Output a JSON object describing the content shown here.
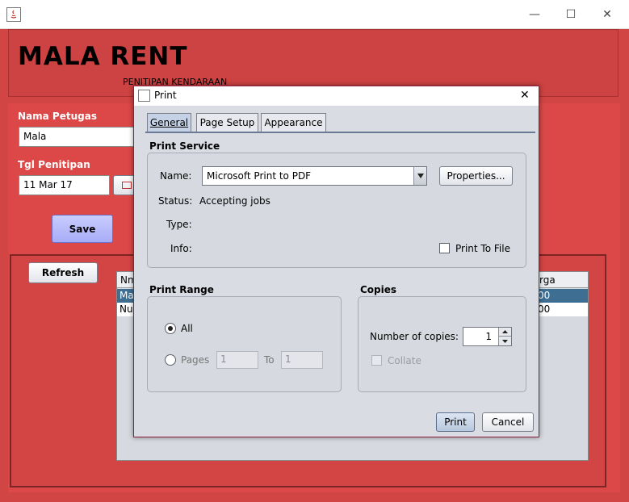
{
  "window": {
    "minimize": "—",
    "maximize": "☐",
    "close": "✕"
  },
  "app": {
    "brand": "MALA RENT",
    "subtitle": "PENITIPAN KENDARAAN",
    "petugas_label": "Nama Petugas",
    "petugas_value": "Mala",
    "tgl_label": "Tgl Penitipan",
    "tgl_value": "11 Mar 17",
    "save_label": "Save",
    "refresh_label": "Refresh",
    "right_hint": "r",
    "table": {
      "header_left": "Nm",
      "header_right": "rga",
      "rows": [
        {
          "left": "Ma",
          "right": "00",
          "selected": true
        },
        {
          "left": "Nu",
          "right": "00",
          "selected": false
        }
      ]
    }
  },
  "dialog": {
    "title": "Print",
    "close": "✕",
    "tabs": [
      "General",
      "Page Setup",
      "Appearance"
    ],
    "print_service": {
      "title": "Print Service",
      "name_label": "Name:",
      "name_value": "Microsoft Print to PDF",
      "properties_label": "Properties...",
      "status_label": "Status:",
      "status_value": "Accepting jobs",
      "type_label": "Type:",
      "info_label": "Info:",
      "print_to_file_label": "Print To File"
    },
    "print_range": {
      "title": "Print Range",
      "all_label": "All",
      "pages_label": "Pages",
      "from_value": "1",
      "to_label": "To",
      "to_value": "1"
    },
    "copies": {
      "title": "Copies",
      "number_label": "Number of copies:",
      "number_value": "1",
      "collate_label": "Collate"
    },
    "print_button": "Print",
    "cancel_button": "Cancel"
  },
  "colors": {
    "app_red": "#d24545",
    "selection_blue": "#3f6e93",
    "dialog_bg": "#d9dce3"
  }
}
